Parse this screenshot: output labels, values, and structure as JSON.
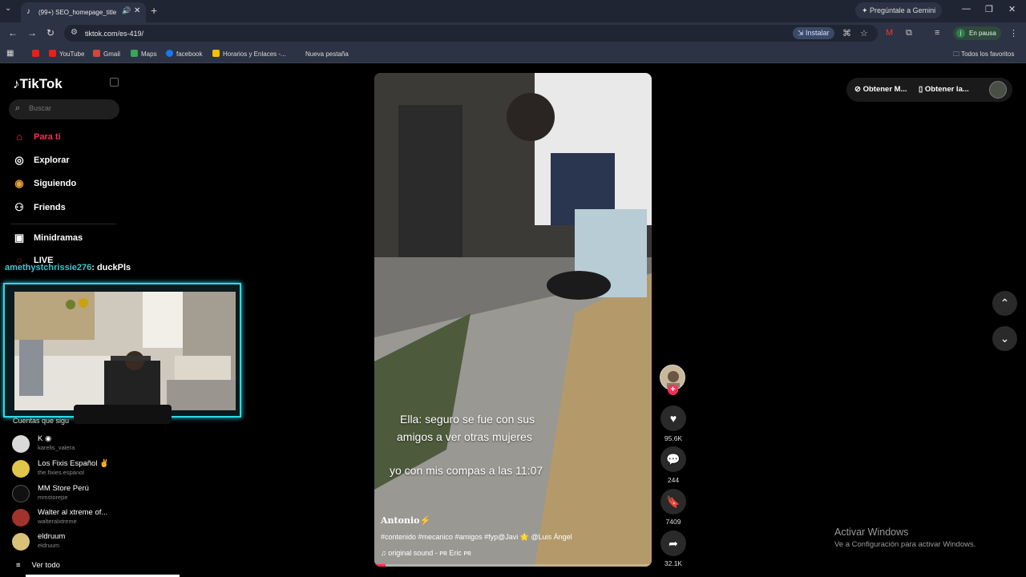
{
  "browser": {
    "tab_title": "(99+) SEO_homepage_title",
    "gemini_label": "Pregúntale a Gemini",
    "url": "tiktok.com/es-419/",
    "install_label": "Instalar",
    "profile_status": "En pausa",
    "profile_initial": "j",
    "bookmarks": [
      "YouTube",
      "Gmail",
      "Maps",
      "facebook",
      "Horarios y Enlaces -...",
      "Nueva pestaña"
    ],
    "all_bookmarks": "Todos los favoritos"
  },
  "sidebar": {
    "logo": "TikTok",
    "search_placeholder": "Buscar",
    "nav": [
      {
        "label": "Para ti",
        "icon": "home-icon"
      },
      {
        "label": "Explorar",
        "icon": "compass-icon"
      },
      {
        "label": "Siguiendo",
        "icon": "following-icon"
      },
      {
        "label": "Friends",
        "icon": "friends-icon"
      },
      {
        "label": "Minidramas",
        "icon": "film-icon"
      },
      {
        "label": "LIVE",
        "icon": "live-icon"
      }
    ],
    "following_title": "Cuentas que sigu",
    "accounts": [
      {
        "name": "K ◉",
        "handle": "karelis_valera",
        "color": "#d9d9d9"
      },
      {
        "name": "Los Fixis Español ✌",
        "handle": "the.fixies.espanol",
        "color": "#e0c64a"
      },
      {
        "name": "MM Store Perú",
        "handle": "mmstorepe",
        "color": "#111111"
      },
      {
        "name": "Walter al xtreme of...",
        "handle": "walteralxtreme",
        "color": "#a0342a"
      },
      {
        "name": "eldruum",
        "handle": "eldruum",
        "color": "#d8c27a"
      }
    ],
    "see_all": "Ver todo"
  },
  "stream": {
    "chat_user": "amethystchrissie276",
    "chat_message": ": duckPls"
  },
  "video": {
    "caption_line1": "Ella: seguro se fue con sus",
    "caption_line2": "amigos a ver otras mujeres",
    "caption_line3": "yo con mis compas a las 11:07",
    "author": "Antonio⚡",
    "description": "#contenido #mecanico #amigos #fyp@Javi 🌟 @Luis Ángel",
    "sound": "original sound - ᴘʀ Eric ᴘʀ",
    "progress": 0.04
  },
  "actions": {
    "likes": "95.6K",
    "comments": "244",
    "saves": "7409",
    "shares": "32.1K"
  },
  "topright": {
    "get_app1": "Obtener M...",
    "get_app2": "Obtener la..."
  },
  "windows_mark": {
    "title": "Activar Windows",
    "subtitle": "Ve a Configuración para activar Windows."
  }
}
